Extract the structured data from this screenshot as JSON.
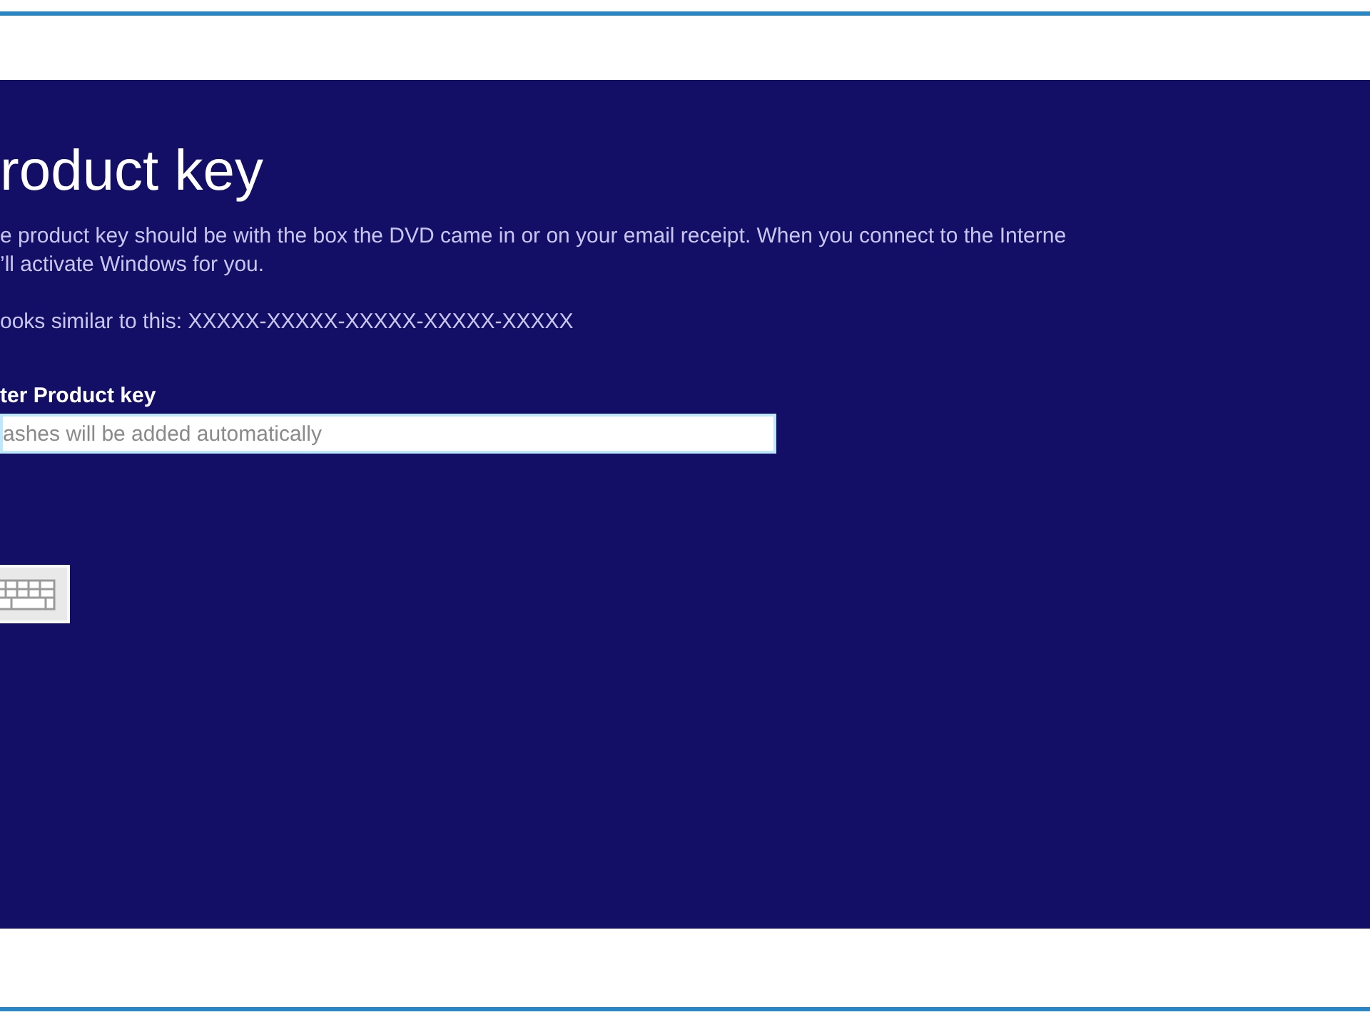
{
  "title": "roduct key",
  "description": [
    "e product key should be with the box the DVD came in or on your email receipt. When you connect to the Interne",
    "’ll activate Windows for you."
  ],
  "example": "ooks similar to this: XXXXX-XXXXX-XXXXX-XXXXX-XXXXX",
  "key_field": {
    "label": "ter Product key",
    "placeholder": "ashes will be added automatically"
  }
}
